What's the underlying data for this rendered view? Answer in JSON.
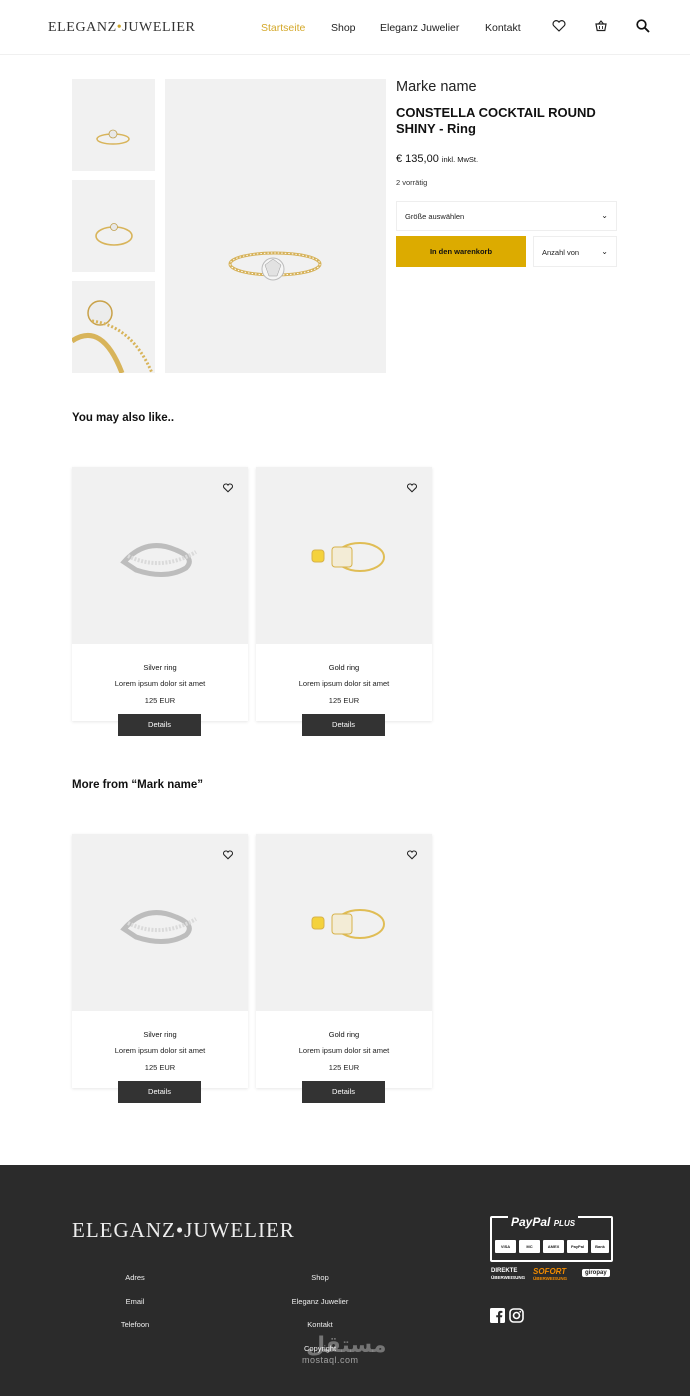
{
  "header": {
    "logo_left": "ELEGANZ",
    "logo_sep": "•",
    "logo_right": "JUWELIER",
    "nav": [
      "Startseite",
      "Shop",
      "Eleganz Juwelier",
      "Kontakt"
    ],
    "icons": [
      "heart-icon",
      "basket-icon",
      "search-icon"
    ],
    "accent_color": "#d4a82a"
  },
  "product": {
    "brand": "Marke name",
    "title": "CONSTELLA COCKTAIL ROUND SHINY - Ring",
    "price": "€ 135,00",
    "price_note": "inkl. MwSt.",
    "stock": "2 vorrätig",
    "size_select": "Größe auswählen",
    "add_to_cart": "In den warenkorb",
    "quantity_select": "Anzahl von",
    "button_color": "#dcab00"
  },
  "sections": {
    "also_like": "You may also like..",
    "more_from": "More from “Mark name”"
  },
  "cards": [
    {
      "name": "Silver ring",
      "desc": "Lorem ipsum dolor sit amet",
      "price": "125 EUR",
      "button": "Details"
    },
    {
      "name": "Gold ring",
      "desc": "Lorem ipsum dolor sit amet",
      "price": "125 EUR",
      "button": "Details"
    },
    {
      "name": "Silver ring",
      "desc": "Lorem ipsum dolor sit amet",
      "price": "125 EUR",
      "button": "Details"
    },
    {
      "name": "Gold ring",
      "desc": "Lorem ipsum dolor sit amet",
      "price": "125 EUR",
      "button": "Details"
    }
  ],
  "footer": {
    "logo_left": "ELEGANZ",
    "logo_sep": "•",
    "logo_right": "JUWELIER",
    "links_left": [
      "Adres",
      "Email",
      "Telefoon"
    ],
    "links_right": [
      "Shop",
      "Eleganz Juwelier",
      "Kontakt",
      "Copyright"
    ],
    "paypal_title": "PayPal",
    "paypal_plus": "PLUS",
    "payment_methods": [
      "VISA",
      "MC",
      "AMEX",
      "PayPal",
      "Bank"
    ],
    "direkte": "DIREKTE",
    "uberweisung": "ÜBERWEISUNG",
    "sofort": "SOFORT",
    "sofort_sub": "ÜBERWEISUNG",
    "giropay": "giropay",
    "social": [
      "facebook-icon",
      "instagram-icon"
    ],
    "watermark_latin": "mostaql.com",
    "watermark_arabic": "مستقل",
    "background": "#2b2b2b"
  }
}
